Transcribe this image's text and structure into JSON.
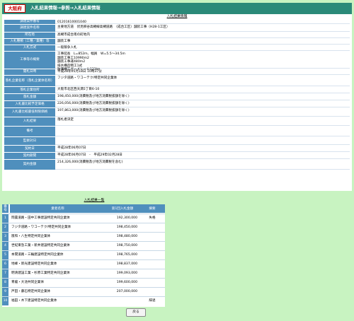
{
  "header": {
    "logo": "大阪府",
    "title": "入札結果情報→参照→入札結果情報"
  },
  "detail": {
    "title": "入札結果情報",
    "fields": [
      {
        "label": "調達案件番号",
        "value": "0120161000104​0"
      },
      {
        "label": "調達案件名称",
        "value": "主要地方道　伏見柳谷高槻線高槻道路　（成合工区）舗装工事（H28-1工区）"
      },
      {
        "label": "所在地",
        "value": "高槻市成合南の町地内"
      },
      {
        "label": "入札種類（工種／業種）等",
        "value": "舗装工事"
      },
      {
        "label": "入札方式",
        "value": "一般競争入札"
      },
      {
        "label": "工事等の概要",
        "value": "工事延長　L=852m、幅員　W=5.5～34.5m\n舗装工事工10990m2\n舗装工事運480m2\n排水構造物工1式\n防護柵工ガードレール123lm"
      },
      {
        "label": "開札日時",
        "value": "平成28年05月18日 10時37分"
      },
      {
        "label": "落札企業名称（落札企業体名称）",
        "value": "フジタ道路・ワコーテク/特定共同企業体"
      },
      {
        "label": "落札企業住所",
        "value": "大阪市北区西天満5丁目6-10"
      },
      {
        "label": "落札金額",
        "value": "198,450,000(消費税及び地方消費税抜額を除く)"
      },
      {
        "label": "入札書比較予定価格",
        "value": "226,056,000(消費税及び地方消費税抜額を除く)"
      },
      {
        "label": "入札書比較最低制限価格",
        "value": "197,863,000(消費税及び地方消費税抜額を除く)"
      },
      {
        "label": "入札結果",
        "value": "落札者決定"
      },
      {
        "label": "備考",
        "value": ""
      },
      {
        "label": "監察対日",
        "value": ""
      },
      {
        "label": "契約日",
        "value": "平成28年06月07日"
      },
      {
        "label": "契約期間",
        "value": "平成28年06月07日　-　平成29年02月28日"
      },
      {
        "label": "契約金額",
        "value": "214,326,000(消費税及び地方消費税を含む)"
      }
    ]
  },
  "results": {
    "title": "入札結果一覧",
    "headers": {
      "num": "番号",
      "name": "業者名称",
      "amount": "第1回入札金額",
      "note": "摘要"
    },
    "rows": [
      {
        "num": "1",
        "name": "岡農道路・田中工事建設特定共同企業体",
        "amount": "192,300,000",
        "note": "失格"
      },
      {
        "num": "2",
        "name": "フジタ道路・ワコーテク/特定共同企業体",
        "amount": "198,450,000",
        "note": ""
      },
      {
        "num": "3",
        "name": "阪和・八生特定共同企業体",
        "amount": "198,480,000",
        "note": ""
      },
      {
        "num": "4",
        "name": "世紀東急工業・新井建設特定共同企業体",
        "amount": "198,750,000",
        "note": ""
      },
      {
        "num": "5",
        "name": "本間道路・三輪建設特定共同企業体",
        "amount": "198,765,000",
        "note": ""
      },
      {
        "num": "6",
        "name": "地峰・新光建設特定共同企業体",
        "amount": "198,837,000",
        "note": ""
      },
      {
        "num": "7",
        "name": "明清建設工業・杉原工業特定共同企業体",
        "amount": "199,093,000",
        "note": ""
      },
      {
        "num": "8",
        "name": "青龍・大池共同企業体",
        "amount": "199,600,000",
        "note": ""
      },
      {
        "num": "9",
        "name": "戸田・藤石特定共同企業体",
        "amount": "207,000,000",
        "note": ""
      },
      {
        "num": "10",
        "name": "福田・木下建設特定共同企業体",
        "amount": "",
        "note": "辞退"
      }
    ]
  },
  "footer": {
    "back_label": "戻る"
  }
}
